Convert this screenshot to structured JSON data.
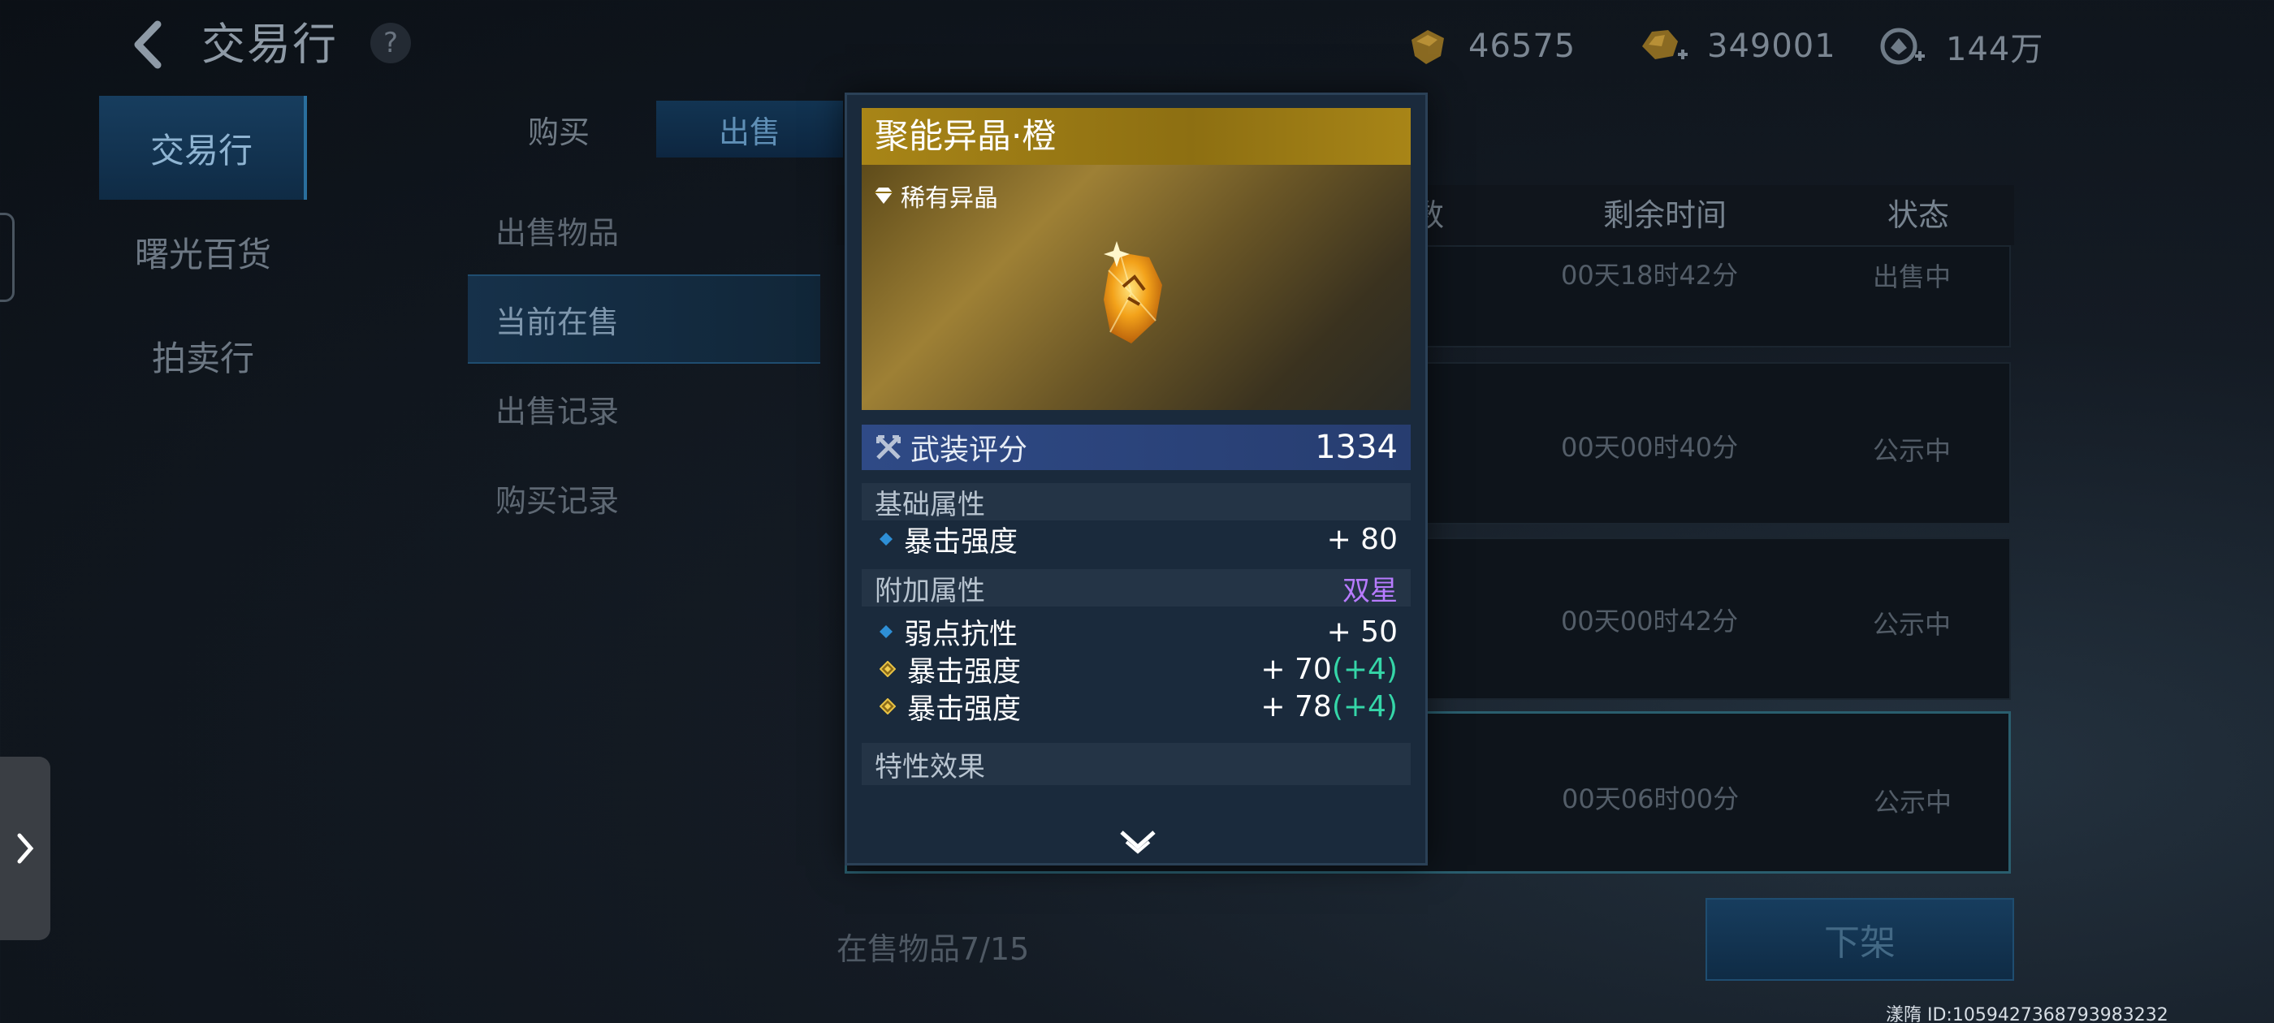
{
  "header": {
    "title": "交易行",
    "help": "?",
    "currencies": [
      {
        "icon": "gold-ingot-icon",
        "value": "46575"
      },
      {
        "icon": "gold-ore-plus-icon",
        "value": "349001"
      },
      {
        "icon": "diamond-plus-icon",
        "value": "144万"
      }
    ]
  },
  "nav": {
    "items": [
      {
        "label": "交易行",
        "active": true
      },
      {
        "label": "曙光百货",
        "active": false
      },
      {
        "label": "拍卖行",
        "active": false
      }
    ]
  },
  "tabs": [
    {
      "label": "购买",
      "active": false
    },
    {
      "label": "出售",
      "active": true
    }
  ],
  "submenu": [
    {
      "label": "出售物品",
      "active": false
    },
    {
      "label": "当前在售",
      "active": true
    },
    {
      "label": "出售记录",
      "active": false
    },
    {
      "label": "购买记录",
      "active": false
    }
  ],
  "table": {
    "headers": [
      "数",
      "剩余时间",
      "状态"
    ],
    "rows": [
      {
        "time": "00天18时42分",
        "status": "出售中"
      },
      {
        "time": "00天00时40分",
        "status": "公示中"
      },
      {
        "time": "00天00时42分",
        "status": "公示中"
      },
      {
        "time": "00天06时00分",
        "status": "公示中"
      }
    ]
  },
  "footer": {
    "count": "在售物品7/15",
    "delist": "下架"
  },
  "user_id": "漾隋 ID:1059427368793983232",
  "popup": {
    "title": "聚能异晶·橙",
    "rarity": "稀有异晶",
    "score_label": "武装评分",
    "score_value": "1334",
    "base_section": "基础属性",
    "base_attrs": [
      {
        "name": "暴击强度",
        "value": "+ 80",
        "bonus": ""
      }
    ],
    "extra_section": "附加属性",
    "extra_tag": "双星",
    "extra_attrs": [
      {
        "name": "弱点抗性",
        "value": "+ 50",
        "bonus": "",
        "marker": "blue"
      },
      {
        "name": "暴击强度",
        "value": "+ 70",
        "bonus": "(+4)",
        "marker": "gold"
      },
      {
        "name": "暴击强度",
        "value": "+ 78",
        "bonus": "(+4)",
        "marker": "gold"
      }
    ],
    "trait_section": "特性效果"
  },
  "colors": {
    "accent_blue": "#173d5e",
    "title_gold": "#a88517",
    "bonus_green": "#35d6a8",
    "star_purple": "#b77bff"
  }
}
